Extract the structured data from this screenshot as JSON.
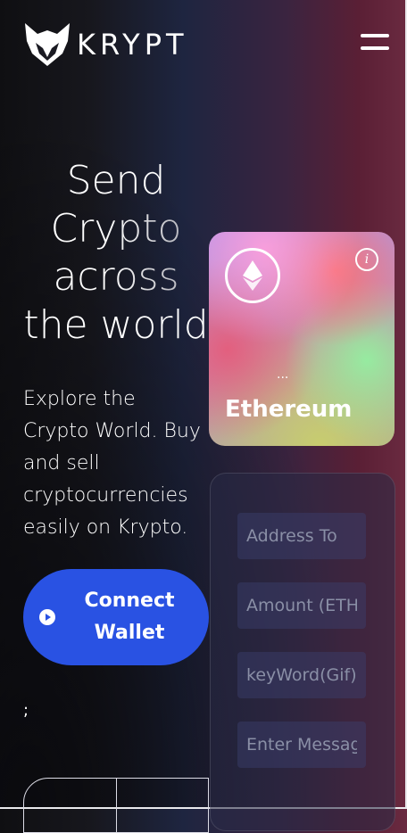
{
  "header": {
    "brand": "KRYPT",
    "menu_icon": "hamburger-icon"
  },
  "hero": {
    "headline": [
      "Send",
      "Crypto",
      "across",
      "the world"
    ],
    "subtitle": "Explore the Crypto World. Buy and sell cryptocurrencies easily on Krypto.",
    "connect_button": "Connect Wallet",
    "ellipsis": ";"
  },
  "eth_card": {
    "address": "...",
    "coin_name": "Ethereum",
    "info_glyph": "i"
  },
  "form": {
    "address_placeholder": "Address To",
    "amount_placeholder": "Amount (ETH)",
    "keyword_placeholder": "keyWord(Gif)",
    "message_placeholder": "Enter Message"
  },
  "colors": {
    "accent": "#2952e3"
  }
}
